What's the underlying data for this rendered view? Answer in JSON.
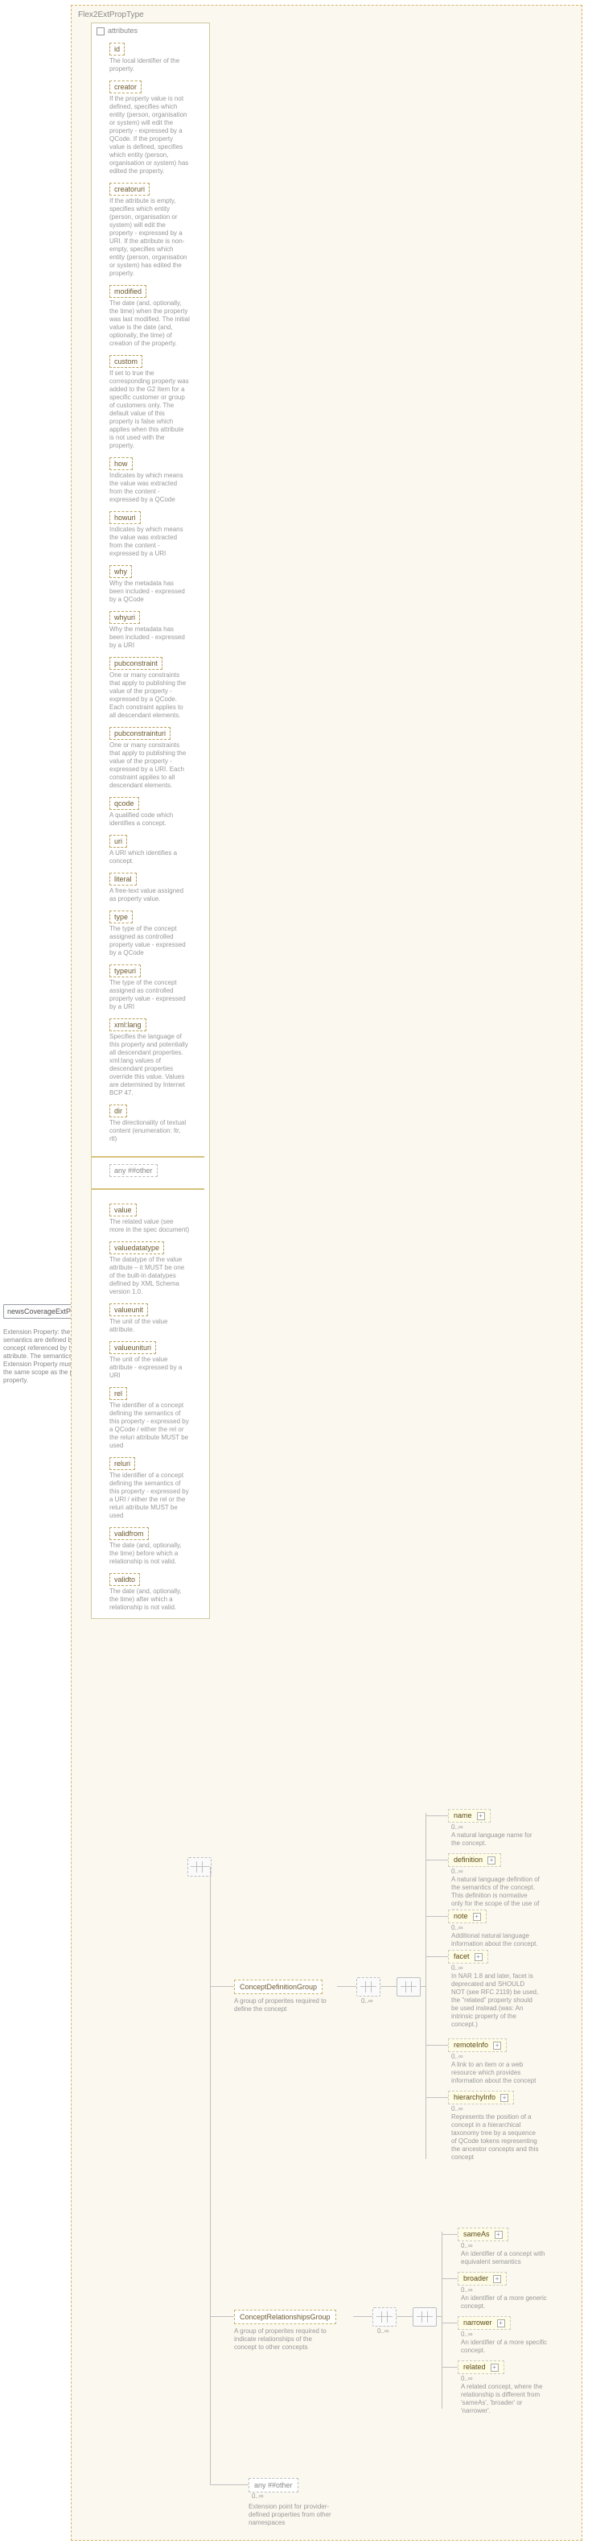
{
  "frame": {
    "title": "Flex2ExtPropType"
  },
  "root": {
    "name": "newsCoverageExtProperty",
    "cardinality": "0..∞",
    "desc": "Extension Property: the semantics are defined by the concept referenced by the rel attribute. The semantics of the Extension Property must have the same scope as the parent property."
  },
  "attr_header": "attributes",
  "attributes": [
    {
      "name": "id",
      "desc": "The local identifier of the property."
    },
    {
      "name": "creator",
      "desc": "If the property value is not defined, specifies which entity (person, organisation or system) will edit the property - expressed by a QCode. If the property value is defined, specifies which entity (person, organisation or system) has edited the property."
    },
    {
      "name": "creatoruri",
      "desc": "If the attribute is empty, specifies which entity (person, organisation or system) will edit the property - expressed by a URI. If the attribute is non-empty, specifies which entity (person, organisation or system) has edited the property."
    },
    {
      "name": "modified",
      "desc": "The date (and, optionally, the time) when the property was last modified. The initial value is the date (and, optionally, the time) of creation of the property."
    },
    {
      "name": "custom",
      "desc": "If set to true the corresponding property was added to the G2 Item for a specific customer or group of customers only. The default value of this property is false which applies when this attribute is not used with the property."
    },
    {
      "name": "how",
      "desc": "Indicates by which means the value was extracted from the content - expressed by a QCode"
    },
    {
      "name": "howuri",
      "desc": "Indicates by which means the value was extracted from the content - expressed by a URI"
    },
    {
      "name": "why",
      "desc": "Why the metadata has been included - expressed by a QCode"
    },
    {
      "name": "whyuri",
      "desc": "Why the metadata has been included - expressed by a URI"
    },
    {
      "name": "pubconstraint",
      "desc": "One or many constraints that apply to publishing the value of the property - expressed by a QCode. Each constraint applies to all descendant elements."
    },
    {
      "name": "pubconstrainturi",
      "desc": "One or many constraints that apply to publishing the value of the property - expressed by a URI. Each constraint applies to all descendant elements."
    },
    {
      "name": "qcode",
      "desc": "A qualified code which identifies a concept."
    },
    {
      "name": "uri",
      "desc": "A URI which identifies a concept."
    },
    {
      "name": "literal",
      "desc": "A free-text value assigned as property value."
    },
    {
      "name": "type",
      "desc": "The type of the concept assigned as controlled property value - expressed by a QCode"
    },
    {
      "name": "typeuri",
      "desc": "The type of the concept assigned as controlled property value - expressed by a URI"
    },
    {
      "name": "xml:lang",
      "desc": "Specifies the language of this property and potentially all descendant properties. xml:lang values of descendant properties override this value. Values are determined by Internet BCP 47."
    },
    {
      "name": "dir",
      "desc": "The directionality of textual content (enumeration: ltr, rtl)"
    }
  ],
  "any_attr": "any  ##other",
  "attributes2": [
    {
      "name": "value",
      "desc": "The related value (see more in the spec document)"
    },
    {
      "name": "valuedatatype",
      "desc": "The datatype of the value attribute – it MUST be one of the built-in datatypes defined by XML Schema version 1.0."
    },
    {
      "name": "valueunit",
      "desc": "The unit of the value attribute."
    },
    {
      "name": "valueunituri",
      "desc": "The unit of the value attribute - expressed by a URI"
    },
    {
      "name": "rel",
      "desc": "The identifier of a concept defining the semantics of this property - expressed by a QCode / either the rel or the reluri attribute MUST be used"
    },
    {
      "name": "reluri",
      "desc": "The identifier of a concept defining the semantics of this property - expressed by a URI / either the rel or the reluri attribute MUST be used"
    },
    {
      "name": "validfrom",
      "desc": "The date (and, optionally, the time) before which a relationship is not valid."
    },
    {
      "name": "validto",
      "desc": "The date (and, optionally, the time) after which a relationship is not valid."
    }
  ],
  "groups": {
    "def": {
      "name": "ConceptDefinitionGroup",
      "desc": "A group of properites required to define the concept"
    },
    "rel": {
      "name": "ConceptRelationshipsGroup",
      "desc": "A group of properites required to indicate relationships of the concept to other concepts"
    }
  },
  "def_children": [
    {
      "name": "name",
      "card": "0..∞",
      "desc": "A natural language name for the concept."
    },
    {
      "name": "definition",
      "card": "0..∞",
      "desc": "A natural language definition of the semantics of the concept. This definition is normative only for the scope of the use of this concept."
    },
    {
      "name": "note",
      "card": "0..∞",
      "desc": "Additional natural language information about the concept."
    },
    {
      "name": "facet",
      "card": "0..∞",
      "desc": "In NAR 1.8 and later, facet is deprecated and SHOULD NOT (see RFC 2119) be used, the \"related\" property should be used instead.(was: An intrinsic property of the concept.)"
    },
    {
      "name": "remoteInfo",
      "card": "0..∞",
      "desc": "A link to an item or a web resource which provides information about the concept"
    },
    {
      "name": "hierarchyInfo",
      "card": "0..∞",
      "desc": "Represents the position of a concept in a hierarchical taxonomy tree by a sequence of QCode tokens representing the ancestor concepts and this concept"
    }
  ],
  "rel_children": [
    {
      "name": "sameAs",
      "card": "0..∞",
      "desc": "An identifier of a concept with equivalent semantics"
    },
    {
      "name": "broader",
      "card": "0..∞",
      "desc": "An identifier of a more generic concept."
    },
    {
      "name": "narrower",
      "card": "0..∞",
      "desc": "An identifier of a more specific concept."
    },
    {
      "name": "related",
      "card": "0..∞",
      "desc": "A related concept, where the relationship is different from 'sameAs', 'broader' or 'narrower'."
    }
  ],
  "any_elem": {
    "name": "any  ##other",
    "card": "0..∞",
    "desc": "Extension point for provider-defined properties from other namespaces"
  },
  "inf": "0..∞"
}
